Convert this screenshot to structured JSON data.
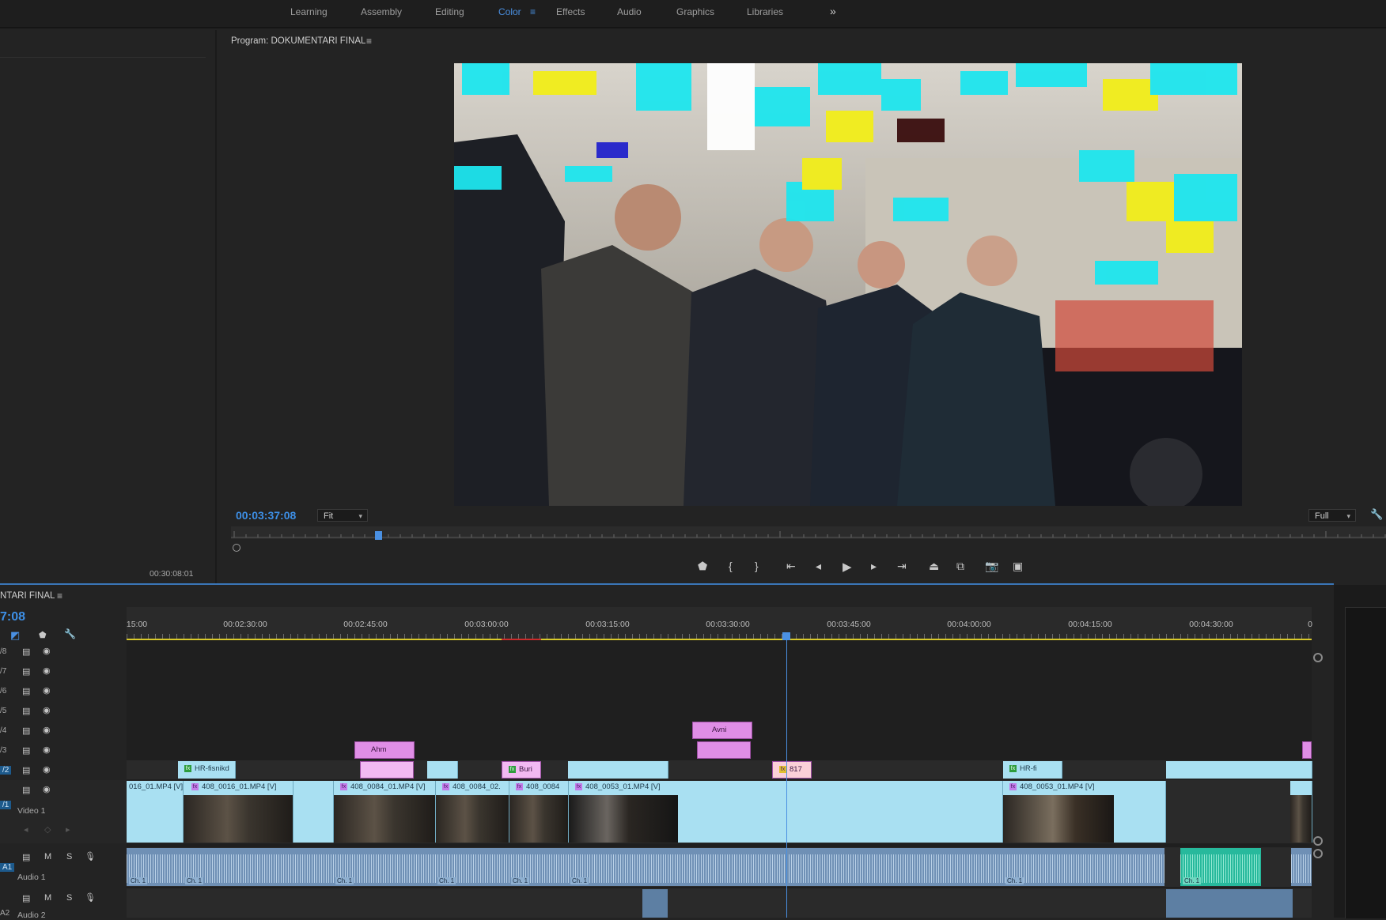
{
  "workspaces": {
    "items": [
      "Learning",
      "Assembly",
      "Editing",
      "Color",
      "Effects",
      "Audio",
      "Graphics",
      "Libraries"
    ],
    "active": "Color",
    "overflow": "»",
    "menu_glyph": "≡"
  },
  "source_panel": {
    "duration": "00:30:08:01"
  },
  "program_monitor": {
    "title": "Program: DOKUMENTARI FINAL",
    "menu_glyph": "≡",
    "timecode": "00:03:37:08",
    "zoom": "Fit",
    "resolution": "Full"
  },
  "timeline": {
    "title": "NTARI FINAL",
    "menu_glyph": "≡",
    "timecode": "7:08",
    "ruler_labels": [
      "15:00",
      "00:02:30:00",
      "00:02:45:00",
      "00:03:00:00",
      "00:03:15:00",
      "00:03:30:00",
      "00:03:45:00",
      "00:04:00:00",
      "00:04:15:00",
      "00:04:30:00",
      "0"
    ],
    "tracks": {
      "v8": "/8",
      "v7": "/7",
      "v6": "/6",
      "v5": "/5",
      "v4": "/4",
      "v3": "/3",
      "v2": "/2",
      "v1": "/1",
      "video1_name": "Video 1",
      "a1": "A1",
      "audio1_name": "Audio 1",
      "a2": "A2",
      "audio2_name": "Audio 2",
      "mute": "M",
      "solo": "S"
    },
    "clips": {
      "v4_avni": "Avni",
      "v3_ahm": "Ahm",
      "v2_hr_fisnikd": "HR-fisnikd",
      "v2_buri": "Buri",
      "v2_817": "817",
      "v2_hr_fi": "HR-fi",
      "v1_c0": "016_01.MP4 [V]",
      "v1_c1": "408_0016_01.MP4 [V]",
      "v1_c2": "408_0084_01.MP4 [V]",
      "v1_c3": "408_0084_02.",
      "v1_c4": "408_0084",
      "v1_c5": "408_0053_01.MP4 [V]",
      "v1_c6": "408_0053_01.MP4 [V]",
      "ch_label": "Ch. 1"
    }
  }
}
